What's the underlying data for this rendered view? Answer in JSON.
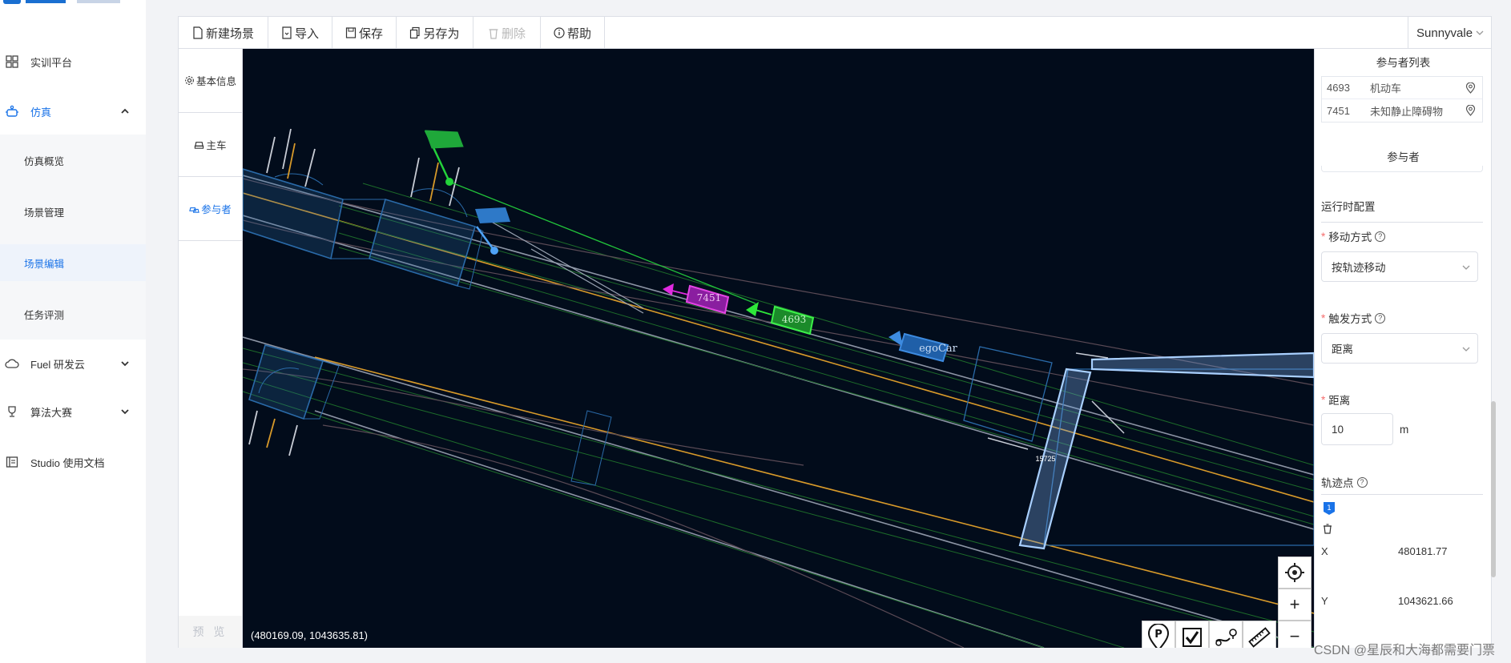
{
  "sidebar": {
    "items": [
      {
        "label": "实训平台",
        "icon": "grid-icon"
      },
      {
        "label": "仿真",
        "icon": "robot-icon",
        "expanded": true
      },
      {
        "label": "Fuel 研发云",
        "icon": "cloud-icon"
      },
      {
        "label": "算法大赛",
        "icon": "trophy-icon"
      },
      {
        "label": "Studio 使用文档",
        "icon": "doc-icon"
      }
    ],
    "sub_items": [
      "仿真概览",
      "场景管理",
      "场景编辑",
      "任务评测"
    ],
    "active_sub": "场景编辑"
  },
  "toolbar": {
    "new_scene": "新建场景",
    "import": "导入",
    "save": "保存",
    "save_as": "另存为",
    "delete": "删除",
    "help": "帮助",
    "city": "Sunnyvale"
  },
  "leftnav": {
    "basic_info": "基本信息",
    "main_car": "主车",
    "participants": "参与者",
    "preview": "预 览"
  },
  "map": {
    "coord_readout": "(480169.09, 1043635.81)",
    "labels": {
      "npc_magenta": "7451",
      "npc_green": "4693",
      "ego": "egoCar",
      "signal_id": "15725"
    },
    "tools": [
      "parking-pin-icon",
      "check-icon",
      "route-icon",
      "ruler-icon"
    ],
    "zoom_in": "+",
    "zoom_out": "−",
    "colors": {
      "background": "#020c1b",
      "lane_white": "#9aa3b2",
      "lane_yellow": "#d89a2a",
      "lane_green": "#1d6b2a",
      "junction": "#2a6aa8",
      "npc_magenta": "#d322d3",
      "npc_green": "#2ee83a",
      "ego": "#3d8be0"
    }
  },
  "right_panel": {
    "participant_list_title": "参与者列表",
    "participants": [
      {
        "id": "4693",
        "type": "机动车"
      },
      {
        "id": "7451",
        "type": "未知静止障碍物"
      }
    ],
    "participant_title": "参与者",
    "runtime_config": "运行时配置",
    "move_mode_label": "移动方式",
    "move_mode_value": "按轨迹移动",
    "trigger_label": "触发方式",
    "trigger_value": "距离",
    "distance_label": "距离",
    "distance_value": "10",
    "distance_unit": "m",
    "trajectory_label": "轨迹点",
    "x_label": "X",
    "x_value": "480181.77",
    "y_label": "Y",
    "y_value": "1043621.66"
  },
  "watermark": "CSDN @星辰和大海都需要门票"
}
